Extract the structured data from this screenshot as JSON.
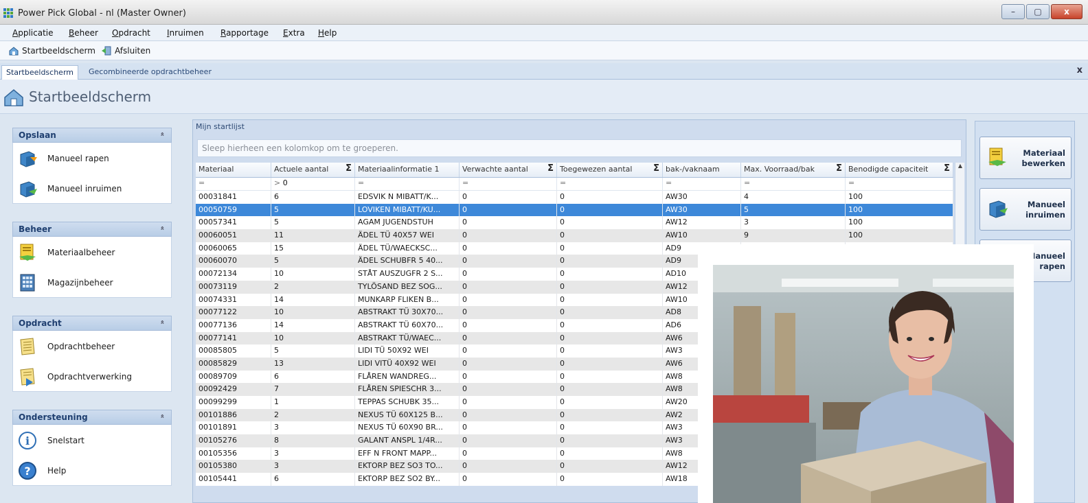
{
  "window": {
    "title": "Power Pick Global - nl (Master Owner)",
    "min": "–",
    "max": "▢",
    "close": "x"
  },
  "menu": [
    "Applicatie",
    "Beheer",
    "Opdracht",
    "Inruimen",
    "Rapportage",
    "Extra",
    "Help"
  ],
  "toolbar": {
    "home": "Startbeeldscherm",
    "exit": "Afsluiten"
  },
  "tabs": {
    "first": "Startbeeldscherm",
    "second": "Gecombineerde opdrachtbeheer",
    "close": "x"
  },
  "page": {
    "title": "Startbeeldscherm"
  },
  "sidebar": {
    "opslaan": {
      "title": "Opslaan",
      "items": [
        "Manueel rapen",
        "Manueel inruimen"
      ]
    },
    "beheer": {
      "title": "Beheer",
      "items": [
        "Materiaalbeheer",
        "Magazijnbeheer"
      ]
    },
    "opdracht": {
      "title": "Opdracht",
      "items": [
        "Opdrachtbeheer",
        "Opdrachtverwerking"
      ]
    },
    "ondersteuning": {
      "title": "Ondersteuning",
      "items": [
        "Snelstart",
        "Help"
      ]
    },
    "chevron": "«"
  },
  "grid": {
    "panel_title": "Mijn startlijst",
    "group_hint": "Sleep hierheen een kolomkop om te groeperen.",
    "columns": [
      "Materiaal",
      "Actuele aantal",
      "Materiaalinformatie 1",
      "Verwachte aantal",
      "Toegewezen aantal",
      "bak-/vaknaam",
      "Max. Voorraad/bak",
      "Benodigde capaciteit"
    ],
    "sigma": "Σ",
    "filter_op": "=",
    "filter_gt": ">",
    "filter_val": "0",
    "rows": [
      [
        "00031841",
        "6",
        "EDSVIK N MIBATT/K...",
        "0",
        "0",
        "AW30",
        "4",
        "100"
      ],
      [
        "00050759",
        "5",
        "LOVIKEN MIBATT/KU...",
        "0",
        "0",
        "AW30",
        "5",
        "100"
      ],
      [
        "00057341",
        "5",
        "AGAM JUGENDSTUH",
        "0",
        "0",
        "AW12",
        "3",
        "100"
      ],
      [
        "00060051",
        "11",
        "ÄDEL TÜ 40X57 WEI",
        "0",
        "0",
        "AW10",
        "9",
        "100"
      ],
      [
        "00060065",
        "15",
        "ÄDEL TÜ/WAECKSC...",
        "0",
        "0",
        "AD9",
        "",
        ""
      ],
      [
        "00060070",
        "5",
        "ÄDEL SCHUBFR 5 40...",
        "0",
        "0",
        "AD9",
        "",
        ""
      ],
      [
        "00072134",
        "10",
        "STÅT AUSZUGFR 2 S...",
        "0",
        "0",
        "AD10",
        "",
        ""
      ],
      [
        "00073119",
        "2",
        "TYLÖSAND BEZ SOG...",
        "0",
        "0",
        "AW12",
        "",
        ""
      ],
      [
        "00074331",
        "14",
        "MUNKARP FLIKEN B...",
        "0",
        "0",
        "AW10",
        "",
        ""
      ],
      [
        "00077122",
        "10",
        "ABSTRAKT TÜ 30X70...",
        "0",
        "0",
        "AD8",
        "",
        ""
      ],
      [
        "00077136",
        "14",
        "ABSTRAKT TÜ 60X70...",
        "0",
        "0",
        "AD6",
        "",
        ""
      ],
      [
        "00077141",
        "10",
        "ABSTRAKT TÜ/WAEC...",
        "0",
        "0",
        "AW6",
        "",
        ""
      ],
      [
        "00085805",
        "5",
        "LIDI TÜ 50X92 WEI",
        "0",
        "0",
        "AW3",
        "",
        ""
      ],
      [
        "00085829",
        "13",
        "LIDI VITÜ 40X92 WEI",
        "0",
        "0",
        "AW6",
        "",
        ""
      ],
      [
        "00089709",
        "6",
        "FLÅREN WANDREG...",
        "0",
        "0",
        "AW8",
        "",
        ""
      ],
      [
        "00092429",
        "7",
        "FLÅREN SPIESCHR 3...",
        "0",
        "0",
        "AW8",
        "",
        ""
      ],
      [
        "00099299",
        "1",
        "TEPPAS SCHUBK 35...",
        "0",
        "0",
        "AW20",
        "",
        ""
      ],
      [
        "00101886",
        "2",
        "NEXUS TÜ 60X125 B...",
        "0",
        "0",
        "AW2",
        "",
        ""
      ],
      [
        "00101891",
        "3",
        "NEXUS TÜ 60X90 BR...",
        "0",
        "0",
        "AW3",
        "",
        ""
      ],
      [
        "00105276",
        "8",
        "GALANT ANSPL 1/4R...",
        "0",
        "0",
        "AW3",
        "",
        ""
      ],
      [
        "00105356",
        "3",
        "EFF N FRONT MAPP...",
        "0",
        "0",
        "AW8",
        "",
        ""
      ],
      [
        "00105380",
        "3",
        "EKTORP BEZ SO3 TO...",
        "0",
        "0",
        "AW12",
        "",
        ""
      ],
      [
        "00105441",
        "6",
        "EKTORP BEZ SO2 BY...",
        "0",
        "0",
        "AW18",
        "",
        ""
      ]
    ]
  },
  "right_buttons": [
    {
      "label": "Materiaal bewerken"
    },
    {
      "label": "Manueel inruimen"
    },
    {
      "label": "Manueel rapen"
    }
  ],
  "colors": {
    "selection": "#3d88d9",
    "header_blue": "#b8cde6",
    "accent_text": "#1f3f70"
  }
}
